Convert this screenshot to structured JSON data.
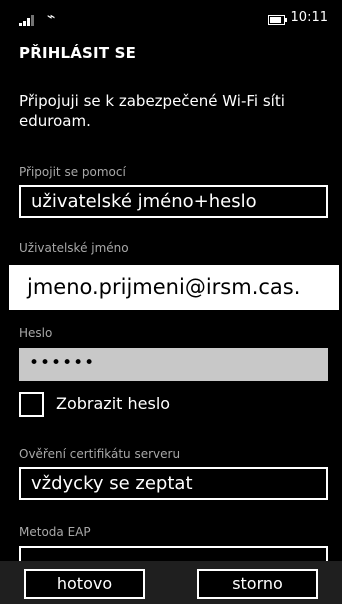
{
  "status_bar": {
    "time": "10:11",
    "icons": [
      "signal-icon",
      "wifi-icon",
      "battery-icon"
    ]
  },
  "header": {
    "title": "PŘIHLÁSIT SE"
  },
  "description": "Připojuji se k zabezpečené Wi-Fi síti eduroam.",
  "connect_with": {
    "label": "Připojit se pomocí",
    "value": "uživatelské jméno+heslo"
  },
  "username": {
    "label": "Uživatelské jméno",
    "value": "jmeno.prijmeni@irsm.cas."
  },
  "password": {
    "label": "Heslo",
    "value": "••••••"
  },
  "show_password": {
    "label": "Zobrazit heslo",
    "checked": false
  },
  "server_cert": {
    "label": "Ověření certifikátu serveru",
    "value": "vždycky se zeptat"
  },
  "eap": {
    "label": "Metoda EAP"
  },
  "appbar": {
    "done_label": "hotovo",
    "cancel_label": "storno"
  }
}
